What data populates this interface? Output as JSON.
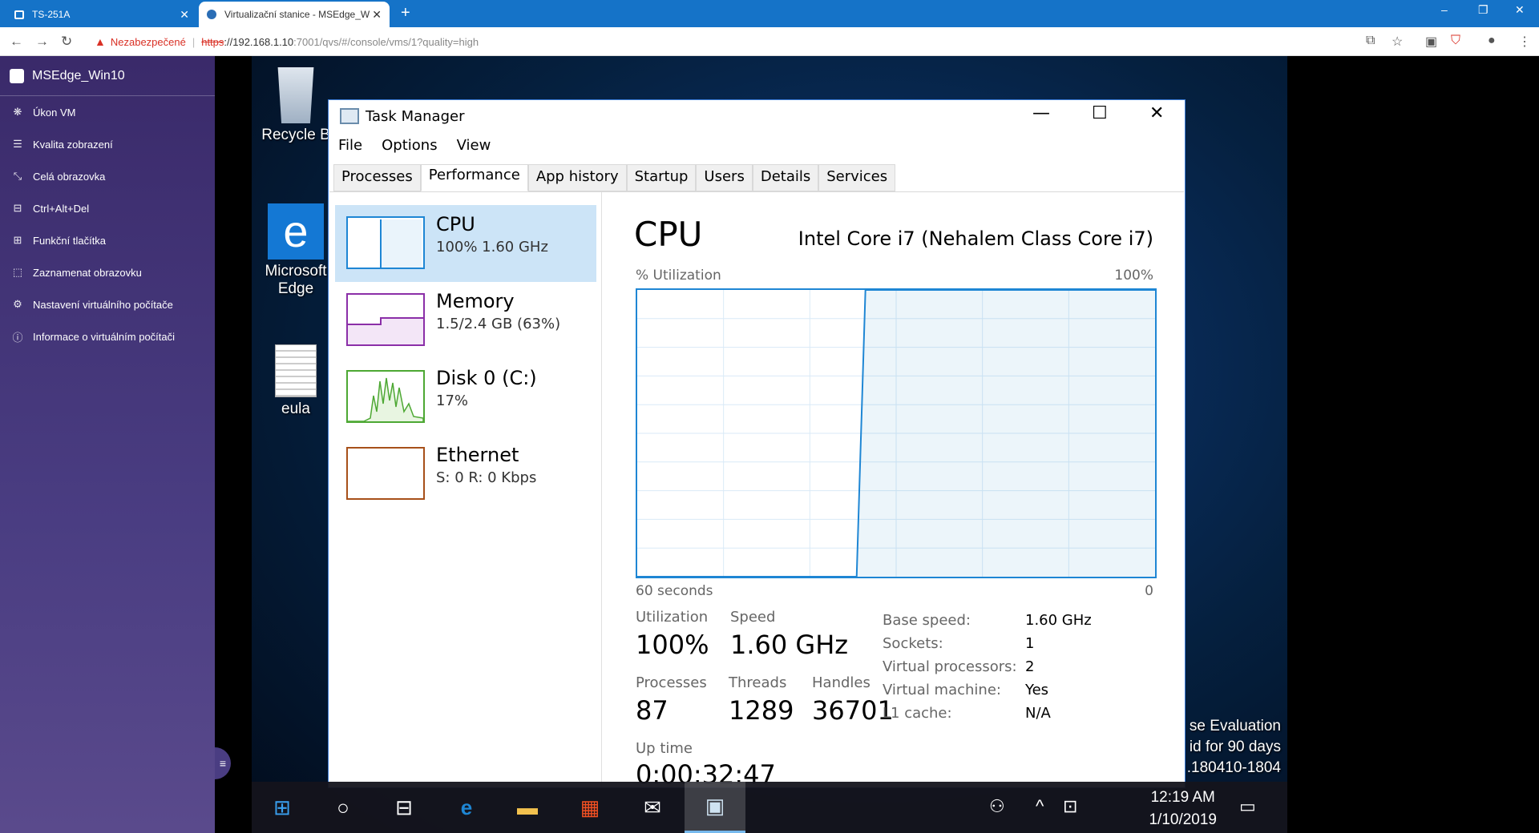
{
  "browser": {
    "tabs": [
      {
        "title": "TS-251A",
        "close": "✕"
      },
      {
        "title": "Virtualizační stanice - MSEdge_W",
        "close": "✕"
      }
    ],
    "new_tab": "+",
    "warning_text": "Nezabezpečené",
    "url_scheme": "https",
    "url_host": "://192.168.1.10",
    "url_path": ":7001/qvs/#/console/vms/1?quality=high"
  },
  "sidebar": {
    "vm_name": "MSEdge_Win10",
    "items": [
      {
        "label": "Úkon VM",
        "icon": "settings-cluster-icon"
      },
      {
        "label": "Kvalita zobrazení",
        "icon": "sliders-icon"
      },
      {
        "label": "Celá obrazovka",
        "icon": "fullscreen-icon"
      },
      {
        "label": "Ctrl+Alt+Del",
        "icon": "keyboard-combo-icon"
      },
      {
        "label": "Funkční tlačítka",
        "icon": "grid-keys-icon"
      },
      {
        "label": "Zaznamenat obrazovku",
        "icon": "record-screen-icon"
      },
      {
        "label": "Nastavení virtuálního počítače",
        "icon": "gear-icon"
      },
      {
        "label": "Informace o virtuálním počítači",
        "icon": "info-icon"
      }
    ]
  },
  "desktop": {
    "icons": [
      "Recycle B",
      "Microsoft Edge",
      "eula"
    ],
    "eval_lines": [
      "se Evaluation",
      "id for 90 days",
      ".180410-1804"
    ]
  },
  "task_manager": {
    "title": "Task Manager",
    "menu": [
      "File",
      "Options",
      "View"
    ],
    "tabs": [
      "Processes",
      "Performance",
      "App history",
      "Startup",
      "Users",
      "Details",
      "Services"
    ],
    "active_tab": "Performance",
    "resources": [
      {
        "name": "CPU",
        "value": "100%  1.60 GHz",
        "color": "#1e86d4"
      },
      {
        "name": "Memory",
        "value": "1.5/2.4 GB (63%)",
        "color": "#8b2fa8"
      },
      {
        "name": "Disk 0 (C:)",
        "value": "17%",
        "color": "#4da833"
      },
      {
        "name": "Ethernet",
        "value": "S: 0 R: 0 Kbps",
        "color": "#a7501a"
      }
    ],
    "cpu": {
      "heading": "CPU",
      "processor": "Intel Core i7 (Nehalem Class Core i7)",
      "util_label": "% Utilization",
      "util_max": "100%",
      "axis_left": "60 seconds",
      "axis_right": "0",
      "utilization_label": "Utilization",
      "utilization": "100%",
      "speed_label": "Speed",
      "speed": "1.60 GHz",
      "processes_label": "Processes",
      "processes": "87",
      "threads_label": "Threads",
      "threads": "1289",
      "handles_label": "Handles",
      "handles": "36701",
      "uptime_label": "Up time",
      "uptime": "0:00:32:47",
      "specs": [
        {
          "label": "Base speed:",
          "value": "1.60 GHz"
        },
        {
          "label": "Sockets:",
          "value": "1"
        },
        {
          "label": "Virtual processors:",
          "value": "2"
        },
        {
          "label": "Virtual machine:",
          "value": "Yes"
        },
        {
          "label": "L1 cache:",
          "value": "N/A"
        }
      ]
    }
  },
  "chart_data": {
    "type": "area",
    "x_range": [
      60,
      0
    ],
    "ylim": [
      0,
      100
    ],
    "grid": true,
    "utilization_series": [
      0,
      0,
      0,
      0,
      0,
      0,
      0,
      0,
      0,
      0,
      0,
      0,
      0,
      0,
      0,
      0,
      0,
      0,
      0,
      0,
      0,
      0,
      0,
      0,
      0,
      0,
      100,
      100,
      100,
      100,
      100,
      100,
      100,
      100,
      100,
      100,
      100,
      100,
      100,
      100,
      100,
      100,
      100,
      100,
      100,
      100,
      100,
      100,
      100,
      100,
      100,
      100,
      100,
      100,
      100,
      100,
      100,
      100,
      100,
      100
    ]
  },
  "taskbar": {
    "time": "12:19 AM",
    "date": "1/10/2019"
  }
}
